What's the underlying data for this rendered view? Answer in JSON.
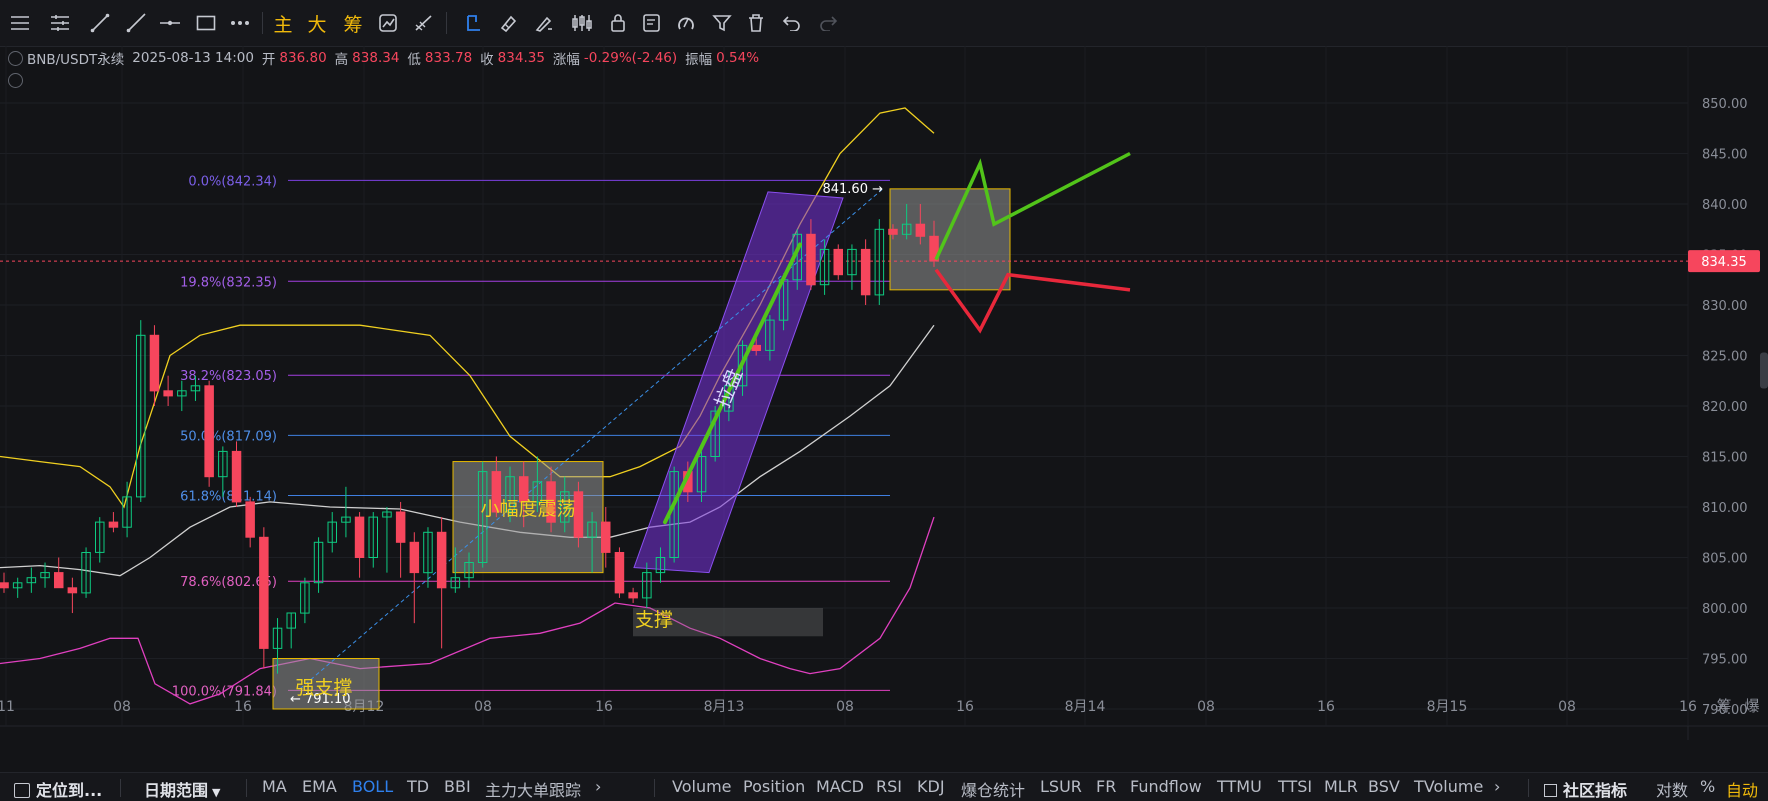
{
  "toolbar": {
    "text_buttons": [
      "主",
      "大",
      "筹"
    ],
    "icons": [
      "menu-icon",
      "settings-icon",
      "trend-line-icon",
      "ray-icon",
      "horizontal-line-icon",
      "rectangle-icon",
      "more-icon",
      "indicator-icon",
      "measure-icon",
      "eraser-icon",
      "pen-icon",
      "candle-icon",
      "lock-icon",
      "note-icon",
      "magnet-icon",
      "filter-icon",
      "trash-icon",
      "undo-icon",
      "redo-icon"
    ]
  },
  "info": {
    "symbol": "BNB/USDT永续",
    "datetime": "2025-08-13 14:00",
    "open_label": "开",
    "open": "836.80",
    "high_label": "高",
    "high": "838.34",
    "low_label": "低",
    "low": "833.78",
    "close_label": "收",
    "close": "834.35",
    "change_label": "涨幅",
    "change": "-0.29%(-2.46)",
    "amp_label": "振幅",
    "amp": "0.54%"
  },
  "colors": {
    "up": "#0ecb81",
    "down": "#f6465d",
    "boll_upper": "#f0d020",
    "boll_mid": "#d0d0d0",
    "boll_lower": "#e040c0",
    "accent": "#f0b90b"
  },
  "chart_data": {
    "type": "candlestick",
    "symbol": "BNB/USDT永续",
    "y_range": [
      788,
      853
    ],
    "price_ticks": [
      "850.00",
      "845.00",
      "840.00",
      "835.00",
      "830.00",
      "825.00",
      "820.00",
      "815.00",
      "810.00",
      "805.00",
      "800.00",
      "795.00",
      "790.00"
    ],
    "current_price": "834.35",
    "time_ticks": [
      "11",
      "08",
      "16",
      "8月12",
      "08",
      "16",
      "8月13",
      "08",
      "16",
      "8月14",
      "08",
      "16",
      "8月15",
      "08",
      "16"
    ],
    "fib_levels": [
      {
        "label": "0.0%(842.34)",
        "price": 842.34
      },
      {
        "label": "19.8%(832.35)",
        "price": 832.35
      },
      {
        "label": "38.2%(823.05)",
        "price": 823.05
      },
      {
        "label": "50.0%(817.09)",
        "price": 817.09
      },
      {
        "label": "61.8%(811.14)",
        "price": 811.14
      },
      {
        "label": "78.6%(802.65)",
        "price": 802.65
      },
      {
        "label": "100.0%(791.84)",
        "price": 791.84
      }
    ],
    "annotations": {
      "high_marker": "841.60",
      "low_marker": "791.10",
      "range_box": "小幅度震荡",
      "support": "支撑",
      "strong_support": "强支撑",
      "channel": "拉盘"
    },
    "candles_ohlc": [
      [
        802.5,
        803.5,
        801.5,
        802.0
      ],
      [
        802.0,
        803.0,
        801.0,
        802.5
      ],
      [
        802.5,
        804.0,
        801.5,
        803.0
      ],
      [
        803.0,
        804.5,
        802.0,
        803.5
      ],
      [
        803.5,
        805.0,
        802.0,
        802.0
      ],
      [
        802.0,
        803.0,
        799.5,
        801.5
      ],
      [
        801.5,
        806.0,
        801.0,
        805.5
      ],
      [
        805.5,
        809.0,
        804.5,
        808.5
      ],
      [
        808.5,
        809.5,
        807.5,
        808.0
      ],
      [
        808.0,
        812.5,
        807.0,
        811.0
      ],
      [
        811.0,
        828.5,
        810.5,
        827.0
      ],
      [
        827.0,
        828.0,
        820.0,
        821.5
      ],
      [
        821.5,
        823.0,
        820.0,
        821.0
      ],
      [
        821.0,
        822.5,
        819.5,
        821.5
      ],
      [
        821.5,
        823.0,
        820.5,
        822.0
      ],
      [
        822.0,
        822.5,
        812.0,
        813.0
      ],
      [
        813.0,
        816.0,
        811.0,
        815.5
      ],
      [
        815.5,
        816.5,
        810.0,
        810.5
      ],
      [
        810.5,
        811.0,
        806.0,
        807.0
      ],
      [
        807.0,
        808.0,
        794.0,
        796.0
      ],
      [
        796.0,
        799.0,
        793.5,
        798.0
      ],
      [
        798.0,
        799.5,
        796.0,
        799.5
      ],
      [
        799.5,
        803.0,
        798.5,
        802.5
      ],
      [
        802.5,
        807.0,
        801.5,
        806.5
      ],
      [
        806.5,
        809.5,
        805.5,
        808.5
      ],
      [
        808.5,
        812.0,
        807.0,
        809.0
      ],
      [
        809.0,
        809.5,
        803.0,
        805.0
      ],
      [
        805.0,
        809.5,
        804.0,
        809.0
      ],
      [
        809.0,
        810.0,
        803.5,
        809.5
      ],
      [
        809.5,
        810.5,
        803.0,
        806.5
      ],
      [
        806.5,
        807.5,
        798.5,
        803.5
      ],
      [
        803.5,
        808.0,
        802.0,
        807.5
      ],
      [
        807.5,
        809.0,
        796.0,
        802.0
      ],
      [
        802.0,
        806.0,
        801.5,
        803.0
      ],
      [
        803.0,
        805.5,
        802.0,
        804.5
      ],
      [
        804.5,
        814.5,
        804.0,
        813.5
      ],
      [
        813.5,
        815.0,
        809.0,
        809.5
      ],
      [
        809.5,
        814.0,
        808.5,
        813.0
      ],
      [
        813.0,
        814.5,
        808.0,
        810.5
      ],
      [
        810.5,
        815.0,
        809.5,
        812.5
      ],
      [
        812.5,
        814.0,
        807.5,
        808.5
      ],
      [
        808.5,
        813.0,
        807.5,
        811.5
      ],
      [
        811.5,
        812.5,
        806.0,
        807.0
      ],
      [
        807.0,
        809.5,
        803.5,
        808.5
      ],
      [
        808.5,
        810.0,
        804.0,
        805.5
      ],
      [
        805.5,
        806.0,
        801.0,
        801.5
      ],
      [
        801.5,
        802.0,
        800.5,
        801.0
      ],
      [
        801.0,
        804.5,
        800.0,
        803.5
      ],
      [
        803.5,
        806.0,
        802.5,
        805.0
      ],
      [
        805.0,
        814.0,
        804.5,
        813.5
      ],
      [
        813.5,
        814.5,
        810.5,
        811.5
      ],
      [
        811.5,
        815.5,
        810.5,
        815.0
      ],
      [
        815.0,
        820.0,
        814.5,
        819.5
      ],
      [
        819.5,
        823.5,
        818.5,
        822.0
      ],
      [
        822.0,
        826.5,
        821.0,
        826.0
      ],
      [
        826.0,
        827.0,
        825.0,
        825.5
      ],
      [
        825.5,
        829.0,
        824.5,
        828.5
      ],
      [
        828.5,
        833.0,
        827.5,
        832.5
      ],
      [
        832.5,
        837.5,
        831.5,
        837.0
      ],
      [
        837.0,
        838.5,
        831.5,
        832.0
      ],
      [
        832.0,
        836.5,
        831.0,
        835.5
      ],
      [
        835.5,
        836.0,
        832.5,
        833.0
      ],
      [
        833.0,
        836.0,
        831.5,
        835.5
      ],
      [
        835.5,
        836.5,
        830.0,
        831.0
      ],
      [
        831.0,
        838.5,
        830.0,
        837.5
      ],
      [
        837.5,
        838.0,
        836.5,
        837.0
      ],
      [
        837.0,
        840.0,
        836.5,
        838.0
      ],
      [
        838.0,
        840.0,
        836.0,
        836.8
      ],
      [
        836.8,
        838.34,
        833.78,
        834.35
      ]
    ]
  },
  "bottom": {
    "locate": "定位到...",
    "date_range": "日期范围",
    "indicators": [
      "MA",
      "EMA",
      "BOLL",
      "TD",
      "BBI",
      "主力大单跟踪"
    ],
    "sub_indicators": [
      "Volume",
      "Position",
      "MACD",
      "RSI",
      "KDJ",
      "爆仓统计",
      "LSUR",
      "FR",
      "Fundflow",
      "TTMU",
      "TTSI",
      "MLR",
      "BSV",
      "TVolume"
    ],
    "community": "社区指标",
    "log": "对数",
    "percent": "%",
    "auto": "自动"
  },
  "corner": {
    "chip": "筹",
    "burst": "爆"
  }
}
